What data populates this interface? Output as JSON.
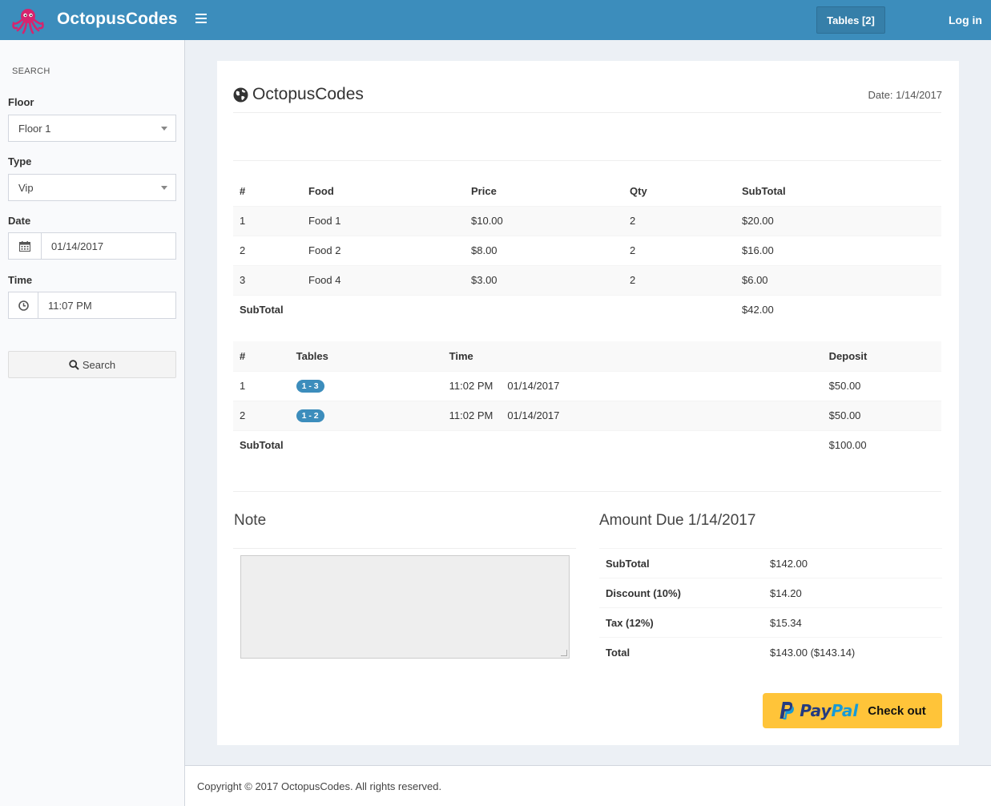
{
  "header": {
    "brand": "OctopusCodes",
    "tables_button": "Tables [2]",
    "login_label": "Log in"
  },
  "sidebar": {
    "section_label": "SEARCH",
    "floor": {
      "label": "Floor",
      "value": "Floor 1"
    },
    "type": {
      "label": "Type",
      "value": "Vip"
    },
    "date": {
      "label": "Date",
      "value": "01/14/2017"
    },
    "time": {
      "label": "Time",
      "value": "11:07 PM"
    },
    "search_button": "Search"
  },
  "invoice": {
    "title": "OctopusCodes",
    "date_text": "Date: 1/14/2017",
    "food_table": {
      "headers": [
        "#",
        "Food",
        "Price",
        "Qty",
        "SubTotal"
      ],
      "rows": [
        [
          "1",
          "Food 1",
          "$10.00",
          "2",
          "$20.00"
        ],
        [
          "2",
          "Food 2",
          "$8.00",
          "2",
          "$16.00"
        ],
        [
          "3",
          "Food 4",
          "$3.00",
          "2",
          "$6.00"
        ]
      ],
      "subtotal_label": "SubTotal",
      "subtotal_value": "$42.00"
    },
    "tables_table": {
      "headers": [
        "#",
        "Tables",
        "Time",
        "Deposit"
      ],
      "rows": [
        {
          "num": "1",
          "table": "1 - 3",
          "time": "11:02 PM",
          "date": "01/14/2017",
          "deposit": "$50.00"
        },
        {
          "num": "2",
          "table": "1 - 2",
          "time": "11:02 PM",
          "date": "01/14/2017",
          "deposit": "$50.00"
        }
      ],
      "subtotal_label": "SubTotal",
      "subtotal_value": "$100.00"
    },
    "note_title": "Note",
    "amount_title": "Amount Due 1/14/2017",
    "amounts": [
      {
        "label": "SubTotal",
        "value": "$142.00"
      },
      {
        "label": "Discount (10%)",
        "value": "$14.20"
      },
      {
        "label": "Tax (12%)",
        "value": "$15.34"
      },
      {
        "label": "Total",
        "value": "$143.00 ($143.14)"
      }
    ],
    "paypal": {
      "pay": "Pay",
      "pal": "Pal",
      "checkout": "Check out"
    }
  },
  "footer": {
    "text": "Copyright © 2017 OctopusCodes. All rights reserved."
  },
  "colors": {
    "primary": "#3c8dbc",
    "paypal_yellow": "#ffc439"
  }
}
